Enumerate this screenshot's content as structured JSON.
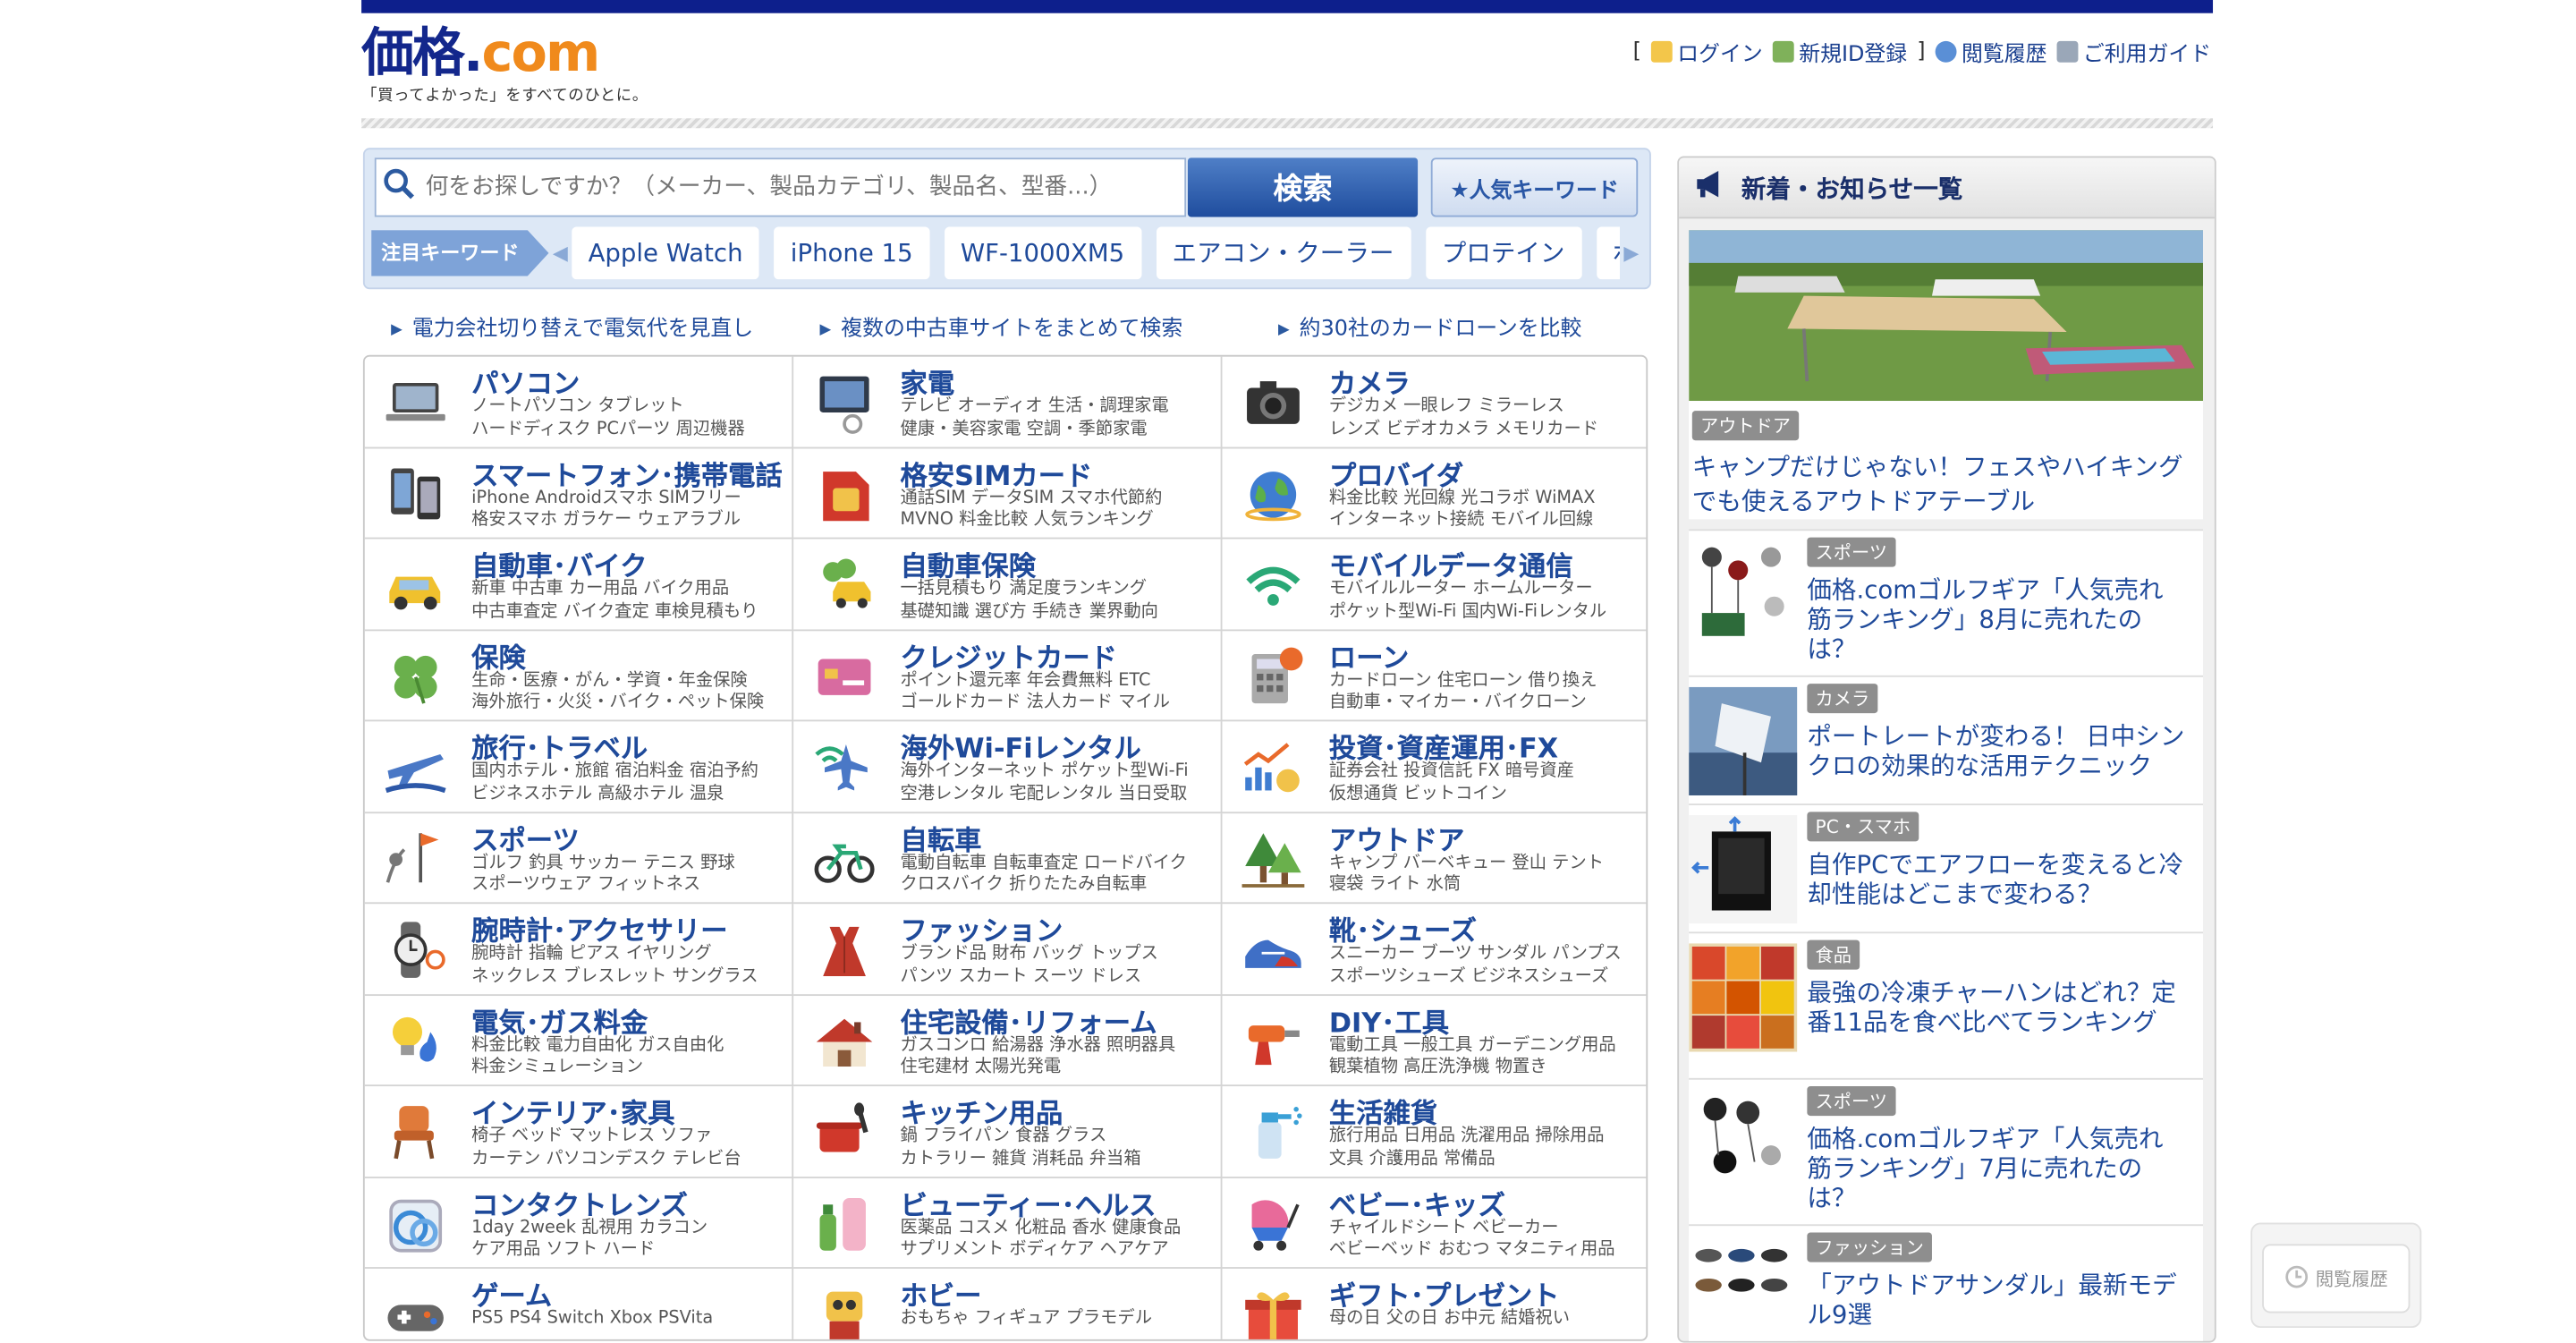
{
  "header": {
    "logo_main": "価格",
    "logo_dot": ".",
    "logo_co": "com",
    "tagline": "「買ってよかった」をすべてのひとに。",
    "bracket_open": "[",
    "bracket_close": "]",
    "login": "ログイン",
    "register": "新規ID登録",
    "history": "閲覧履歴",
    "guide": "ご利用ガイド"
  },
  "search": {
    "placeholder": "何をお探しですか？（メーカー、製品カテゴリ、製品名、型番...）",
    "button": "検索",
    "popular_button": "★人気キーワード",
    "keyword_label": "注目キーワード",
    "keywords": [
      "Apple Watch",
      "iPhone 15",
      "WF-1000XM5",
      "エアコン・クーラー",
      "プロテイン",
      "ポータブル"
    ]
  },
  "promos": [
    "電力会社切り替えで電気代を見直し",
    "複数の中古車サイトをまとめて検索",
    "約30社のカードローンを比較"
  ],
  "categories": [
    {
      "title": "パソコン",
      "l1": "ノートパソコン タブレット",
      "l2": "ハードディスク PCパーツ 周辺機器"
    },
    {
      "title": "家電",
      "l1": "テレビ オーディオ 生活・調理家電",
      "l2": "健康・美容家電 空調・季節家電"
    },
    {
      "title": "カメラ",
      "l1": "デジカメ 一眼レフ ミラーレス",
      "l2": "レンズ ビデオカメラ メモリカード"
    },
    {
      "title": "スマートフォン･携帯電話",
      "l1": "iPhone Androidスマホ SIMフリー",
      "l2": "格安スマホ ガラケー ウェアラブル"
    },
    {
      "title": "格安SIMカード",
      "l1": "通話SIM データSIM スマホ代節約",
      "l2": "MVNO 料金比較 人気ランキング"
    },
    {
      "title": "プロバイダ",
      "l1": "料金比較 光回線 光コラボ WiMAX",
      "l2": "インターネット接続 モバイル回線"
    },
    {
      "title": "自動車･バイク",
      "l1": "新車 中古車 カー用品 バイク用品",
      "l2": "中古車査定 バイク査定 車検見積もり"
    },
    {
      "title": "自動車保険",
      "l1": "一括見積もり 満足度ランキング",
      "l2": "基礎知識 選び方 手続き 業界動向"
    },
    {
      "title": "モバイルデータ通信",
      "l1": "モバイルルーター ホームルーター",
      "l2": "ポケット型Wi-Fi 国内Wi-Fiレンタル"
    },
    {
      "title": "保険",
      "l1": "生命・医療・がん・学資・年金保険",
      "l2": "海外旅行・火災・バイク・ペット保険"
    },
    {
      "title": "クレジットカード",
      "l1": "ポイント還元率 年会費無料 ETC",
      "l2": "ゴールドカード 法人カード マイル"
    },
    {
      "title": "ローン",
      "l1": "カードローン 住宅ローン 借り換え",
      "l2": "自動車・マイカー・バイクローン"
    },
    {
      "title": "旅行･トラベル",
      "l1": "国内ホテル・旅館 宿泊料金 宿泊予約",
      "l2": "ビジネスホテル 高級ホテル 温泉"
    },
    {
      "title": "海外Wi-Fiレンタル",
      "l1": "海外インターネット ポケット型Wi-Fi",
      "l2": "空港レンタル 宅配レンタル 当日受取"
    },
    {
      "title": "投資･資産運用･FX",
      "l1": "証券会社 投資信託 FX 暗号資産",
      "l2": "仮想通貨 ビットコイン"
    },
    {
      "title": "スポーツ",
      "l1": "ゴルフ 釣具 サッカー テニス 野球",
      "l2": "スポーツウェア フィットネス"
    },
    {
      "title": "自転車",
      "l1": "電動自転車 自転車査定 ロードバイク",
      "l2": "クロスバイク 折りたたみ自転車"
    },
    {
      "title": "アウトドア",
      "l1": "キャンプ バーベキュー 登山 テント",
      "l2": "寝袋 ライト 水筒"
    },
    {
      "title": "腕時計･アクセサリー",
      "l1": "腕時計 指輪 ピアス イヤリング",
      "l2": "ネックレス ブレスレット サングラス"
    },
    {
      "title": "ファッション",
      "l1": "ブランド品 財布 バッグ トップス",
      "l2": "パンツ スカート スーツ ドレス"
    },
    {
      "title": "靴･シューズ",
      "l1": "スニーカー ブーツ サンダル パンプス",
      "l2": "スポーツシューズ ビジネスシューズ"
    },
    {
      "title": "電気･ガス料金",
      "l1": "料金比較 電力自由化 ガス自由化",
      "l2": "料金シミュレーション"
    },
    {
      "title": "住宅設備･リフォーム",
      "l1": "ガスコンロ 給湯器 浄水器 照明器具",
      "l2": "住宅建材 太陽光発電"
    },
    {
      "title": "DIY･工具",
      "l1": "電動工具 一般工具 ガーデニング用品",
      "l2": "観葉植物 高圧洗浄機 物置き"
    },
    {
      "title": "インテリア･家具",
      "l1": "椅子 ベッド マットレス ソファ",
      "l2": "カーテン パソコンデスク テレビ台"
    },
    {
      "title": "キッチン用品",
      "l1": "鍋 フライパン 食器 グラス",
      "l2": "カトラリー 雑貨 消耗品 弁当箱"
    },
    {
      "title": "生活雑貨",
      "l1": "旅行用品 日用品 洗濯用品 掃除用品",
      "l2": "文具 介護用品 常備品"
    },
    {
      "title": "コンタクトレンズ",
      "l1": "1day 2week 乱視用 カラコン",
      "l2": "ケア用品 ソフト ハード"
    },
    {
      "title": "ビューティー･ヘルス",
      "l1": "医薬品 コスメ 化粧品 香水 健康食品",
      "l2": "サプリメント ボディケア ヘアケア"
    },
    {
      "title": "ベビー･キッズ",
      "l1": "チャイルドシート ベビーカー",
      "l2": "ベビーベッド おむつ マタニティ用品"
    },
    {
      "title": "ゲーム",
      "l1": "PS5 PS4 Switch Xbox PSVita",
      "l2": ""
    },
    {
      "title": "ホビー",
      "l1": "おもちゃ フィギュア プラモデル",
      "l2": ""
    },
    {
      "title": "ギフト･プレゼント",
      "l1": "母の日 父の日 お中元 結婚祝い",
      "l2": ""
    }
  ],
  "category_icons": [
    "laptop-icon",
    "appliance-icon",
    "camera-icon",
    "smartphone-icon",
    "sim-card-icon",
    "globe-icon",
    "car-icon",
    "car-insurance-icon",
    "wifi-icon",
    "clover-icon",
    "credit-card-icon",
    "calculator-icon",
    "airplane-icon",
    "wifi-plane-icon",
    "chart-yen-icon",
    "golf-icon",
    "bicycle-icon",
    "tree-icon",
    "watch-icon",
    "dress-icon",
    "shoe-icon",
    "bulb-flame-icon",
    "house-icon",
    "drill-icon",
    "chair-icon",
    "pot-icon",
    "spray-icon",
    "contact-lens-icon",
    "cosmetics-icon",
    "stroller-icon",
    "gamepad-icon",
    "robot-icon",
    "gift-icon"
  ],
  "news": {
    "heading": "新着・お知らせ一覧",
    "feature": {
      "tag": "アウトドア",
      "title": "キャンプだけじゃない！フェスやハイキングでも使えるアウトドアテーブル"
    },
    "items": [
      {
        "tag": "スポーツ",
        "title": "価格.comゴルフギア「人気売れ筋ランキング」8月に売れたのは？"
      },
      {
        "tag": "カメラ",
        "title": "ポートレートが変わる！ 日中シンクロの効果的な活用テクニック"
      },
      {
        "tag": "PC・スマホ",
        "title": "自作PCでエアフローを変えると冷却性能はどこまで変わる？"
      },
      {
        "tag": "食品",
        "title": "最強の冷凍チャーハンはどれ？定番11品を食べ比べてランキング"
      },
      {
        "tag": "スポーツ",
        "title": "価格.comゴルフギア「人気売れ筋ランキング」7月に売れたのは？"
      },
      {
        "tag": "ファッション",
        "title": "「アウトドアサンダル」最新モデル9選"
      }
    ]
  },
  "history_button": "閲覧履歴",
  "colors": {
    "brand_navy": "#0d1f8c",
    "link_blue": "#1f4a9a",
    "search_btn": "#2a5aa8",
    "accent_orange": "#f08a1c"
  }
}
